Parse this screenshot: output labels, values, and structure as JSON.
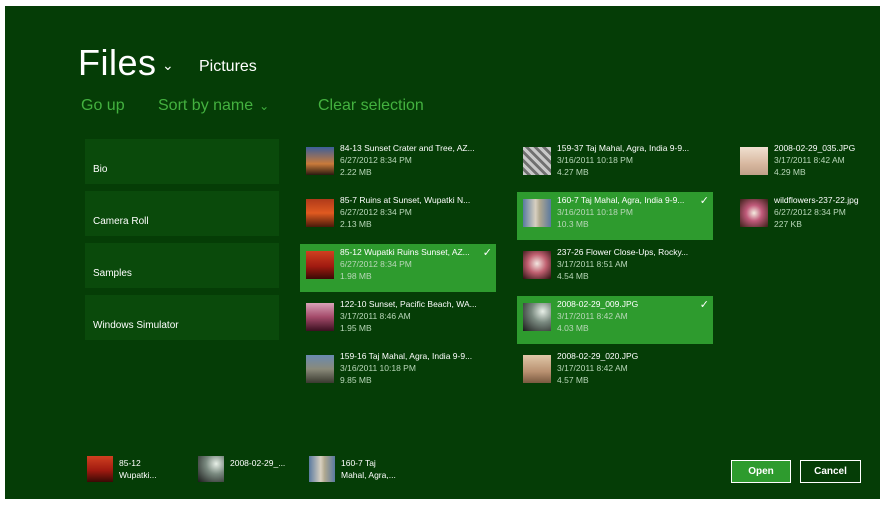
{
  "header": {
    "title": "Files",
    "location": "Pictures"
  },
  "commands": {
    "go_up": "Go up",
    "sort": "Sort by name",
    "clear_selection": "Clear selection"
  },
  "folders": [
    "Bio",
    "Camera Roll",
    "Samples",
    "Windows Simulator"
  ],
  "files": [
    {
      "name": "84-13 Sunset Crater and Tree, AZ...",
      "date": "6/27/2012 8:34 PM",
      "size": "2.22 MB",
      "selected": false
    },
    {
      "name": "85-7 Ruins at Sunset, Wupatki N...",
      "date": "6/27/2012 8:34 PM",
      "size": "2.13 MB",
      "selected": false
    },
    {
      "name": "85-12 Wupatki Ruins Sunset, AZ...",
      "date": "6/27/2012 8:34 PM",
      "size": "1.98 MB",
      "selected": true
    },
    {
      "name": "122-10 Sunset, Pacific Beach, WA...",
      "date": "3/17/2011 8:46 AM",
      "size": "1.95 MB",
      "selected": false
    },
    {
      "name": "159-16 Taj Mahal, Agra, India 9-9...",
      "date": "3/16/2011 10:18 PM",
      "size": "9.85 MB",
      "selected": false
    },
    {
      "name": "159-37 Taj Mahal, Agra, India 9-9...",
      "date": "3/16/2011 10:18 PM",
      "size": "4.27 MB",
      "selected": false
    },
    {
      "name": "160-7 Taj Mahal, Agra, India 9-9...",
      "date": "3/16/2011 10:18 PM",
      "size": "10.3 MB",
      "selected": true
    },
    {
      "name": "237-26 Flower Close-Ups, Rocky...",
      "date": "3/17/2011 8:51 AM",
      "size": "4.54 MB",
      "selected": false
    },
    {
      "name": "2008-02-29_009.JPG",
      "date": "3/17/2011 8:42 AM",
      "size": "4.03 MB",
      "selected": true
    },
    {
      "name": "2008-02-29_020.JPG",
      "date": "3/17/2011 8:42 AM",
      "size": "4.57 MB",
      "selected": false
    },
    {
      "name": "2008-02-29_035.JPG",
      "date": "3/17/2011 8:42 AM",
      "size": "4.29 MB",
      "selected": false
    },
    {
      "name": "wildflowers-237-22.jpg",
      "date": "6/27/2012 8:34 PM",
      "size": "227 KB",
      "selected": false
    }
  ],
  "basket": [
    {
      "line1": "85-12",
      "line2": "Wupatki..."
    },
    {
      "line1": "2008-02-29_...",
      "line2": ""
    },
    {
      "line1": "160-7 Taj",
      "line2": "Mahal, Agra,..."
    }
  ],
  "buttons": {
    "open": "Open",
    "cancel": "Cancel"
  },
  "icons": {
    "check": "✓",
    "chevron": "⌄"
  },
  "colors": {
    "background": "#053d06",
    "accent": "#43b13f",
    "selected": "#2e9b2e"
  }
}
